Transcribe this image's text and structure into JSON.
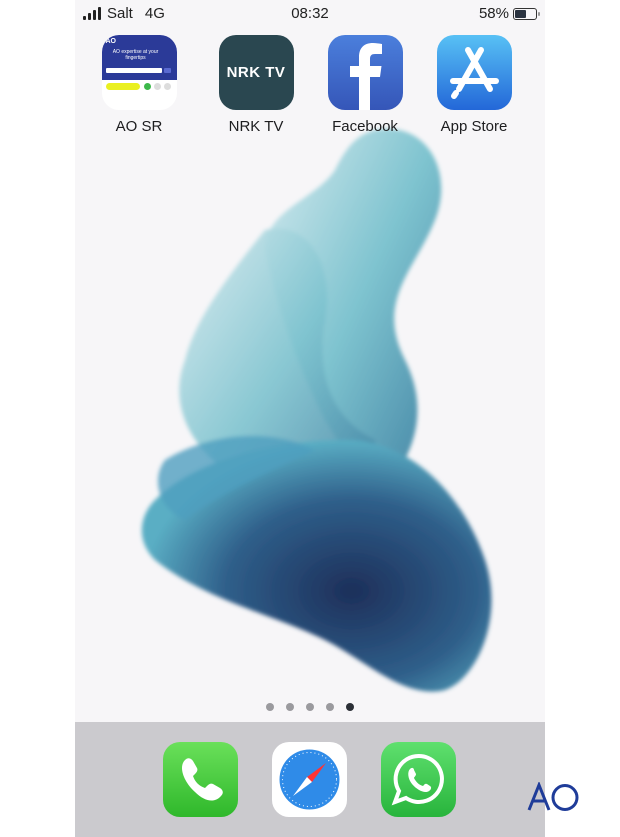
{
  "status_bar": {
    "carrier": "Salt",
    "network": "4G",
    "time": "08:32",
    "battery_percent": "58%",
    "battery_level": 0.58
  },
  "apps": [
    {
      "label": "AO SR",
      "icon": "ao-sr-icon",
      "icon_text": "AO expertise at your fingertips"
    },
    {
      "label": "NRK TV",
      "icon": "nrk-tv-icon",
      "icon_text": "NRK TV"
    },
    {
      "label": "Facebook",
      "icon": "facebook-icon"
    },
    {
      "label": "App Store",
      "icon": "app-store-icon"
    }
  ],
  "page_indicator": {
    "count": 5,
    "active": 5
  },
  "dock": [
    {
      "name": "Phone",
      "icon": "phone-icon"
    },
    {
      "name": "Safari",
      "icon": "safari-icon"
    },
    {
      "name": "WhatsApp",
      "icon": "whatsapp-icon"
    }
  ],
  "watermark": {
    "text": "AO",
    "color": "#1f3c99"
  },
  "colors": {
    "ao_blue": "#2b3a98",
    "nrk": "#2a4750",
    "facebook": "#3b63c4",
    "appstore": "#2f8fe8",
    "phone": "#4cd044",
    "whatsapp": "#3cc94c"
  }
}
